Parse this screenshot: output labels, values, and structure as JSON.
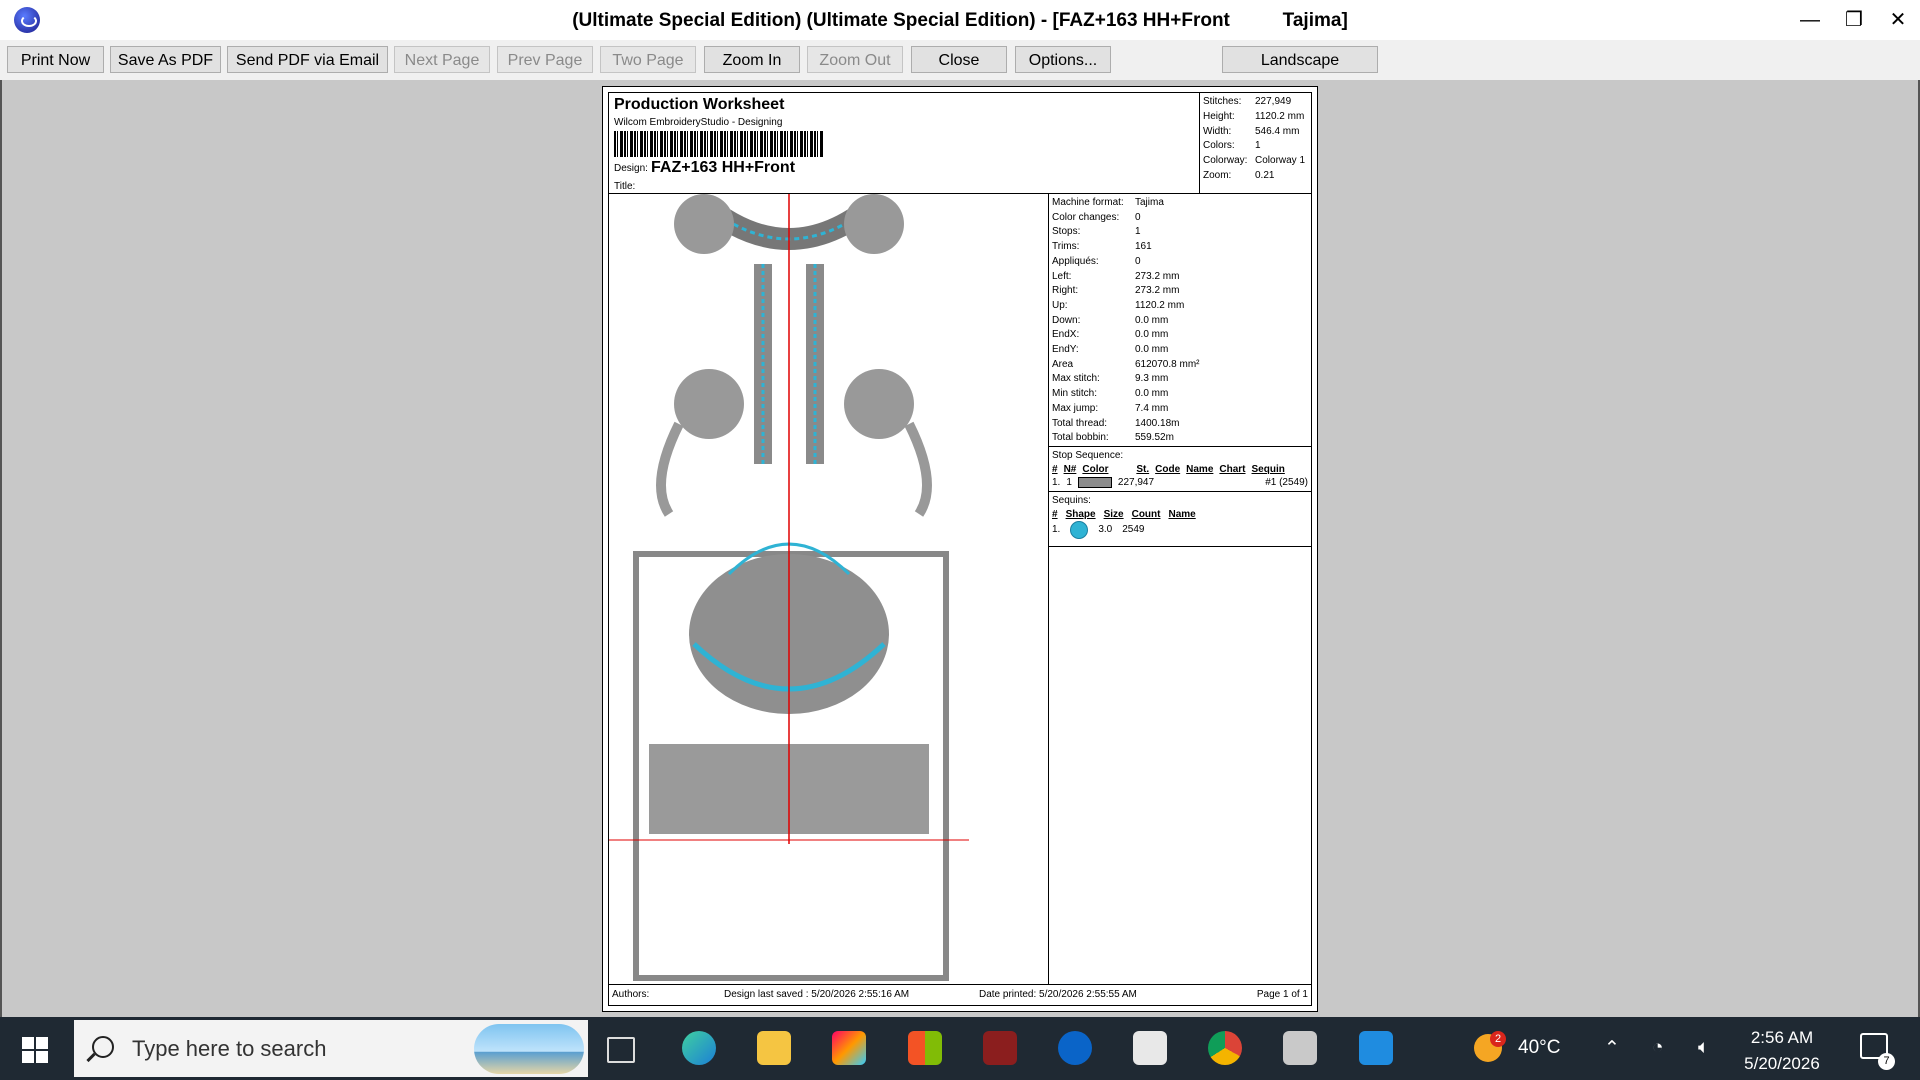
{
  "window": {
    "title": "(Ultimate Special Edition) (Ultimate Special Edition) - [FAZ+163 HH+Front          Tajima]",
    "minimize": "—",
    "restore": "❐",
    "close": "✕"
  },
  "toolbar": {
    "print_now": "Print Now",
    "save_pdf": "Save As PDF",
    "send_pdf": "Send PDF via Email",
    "next_page": "Next Page",
    "prev_page": "Prev Page",
    "two_page": "Two Page",
    "zoom_in": "Zoom In",
    "zoom_out": "Zoom Out",
    "close": "Close",
    "options": "Options...",
    "landscape": "Landscape"
  },
  "worksheet": {
    "title": "Production Worksheet",
    "subtitle": "Wilcom EmbroideryStudio - Designing",
    "design_label": "Design:",
    "design_value": "FAZ+163 HH+Front",
    "title_label": "Title:",
    "stats": [
      {
        "k": "Stitches:",
        "v": "227,949"
      },
      {
        "k": "Height:",
        "v": "1120.2 mm"
      },
      {
        "k": "Width:",
        "v": "546.4 mm"
      },
      {
        "k": "Colors:",
        "v": "1"
      },
      {
        "k": "Colorway:",
        "v": "Colorway 1"
      },
      {
        "k": "Zoom:",
        "v": "0.21"
      }
    ],
    "machine": [
      {
        "k": "Machine format:",
        "v": "Tajima"
      },
      {
        "k": "Color changes:",
        "v": "0"
      },
      {
        "k": "Stops:",
        "v": "1"
      },
      {
        "k": "Trims:",
        "v": "161"
      },
      {
        "k": "Appliqués:",
        "v": "0"
      },
      {
        "k": "Left:",
        "v": "273.2 mm"
      },
      {
        "k": "Right:",
        "v": "273.2 mm"
      },
      {
        "k": "Up:",
        "v": "1120.2 mm"
      },
      {
        "k": "Down:",
        "v": "0.0 mm"
      },
      {
        "k": "EndX:",
        "v": "0.0 mm"
      },
      {
        "k": "EndY:",
        "v": "0.0 mm"
      },
      {
        "k": "Area",
        "v": "612070.8 mm²"
      },
      {
        "k": "Max stitch:",
        "v": "9.3 mm"
      },
      {
        "k": "Min stitch:",
        "v": "0.0 mm"
      },
      {
        "k": "Max jump:",
        "v": "7.4 mm"
      },
      {
        "k": "Total thread:",
        "v": "1400.18m"
      },
      {
        "k": "Total bobbin:",
        "v": "559.52m"
      }
    ],
    "stop_sequence": {
      "title": "Stop Sequence:",
      "headers": [
        "#",
        "N#",
        "Color",
        "St.",
        "Code",
        "Name",
        "Chart",
        "Sequin"
      ],
      "row": {
        "num": "1.",
        "n": "1",
        "st": "227,947",
        "sequin": "#1 (2549)"
      }
    },
    "sequins": {
      "title": "Sequins:",
      "headers": [
        "#",
        "Shape",
        "Size",
        "Count",
        "Name"
      ],
      "row": {
        "num": "1.",
        "size": "3.0",
        "count": "2549"
      }
    },
    "footer": {
      "authors": "Authors:",
      "saved": "Design last saved : 5/20/2026 2:55:16 AM",
      "printed": "Date printed: 5/20/2026 2:55:55 AM",
      "page": "Page 1 of 1"
    }
  },
  "taskbar": {
    "search_placeholder": "Type here to search",
    "weather_badge": "2",
    "temperature": "40°C",
    "time": "2:56 AM",
    "date": "5/20/2026",
    "notification_count": "7"
  }
}
